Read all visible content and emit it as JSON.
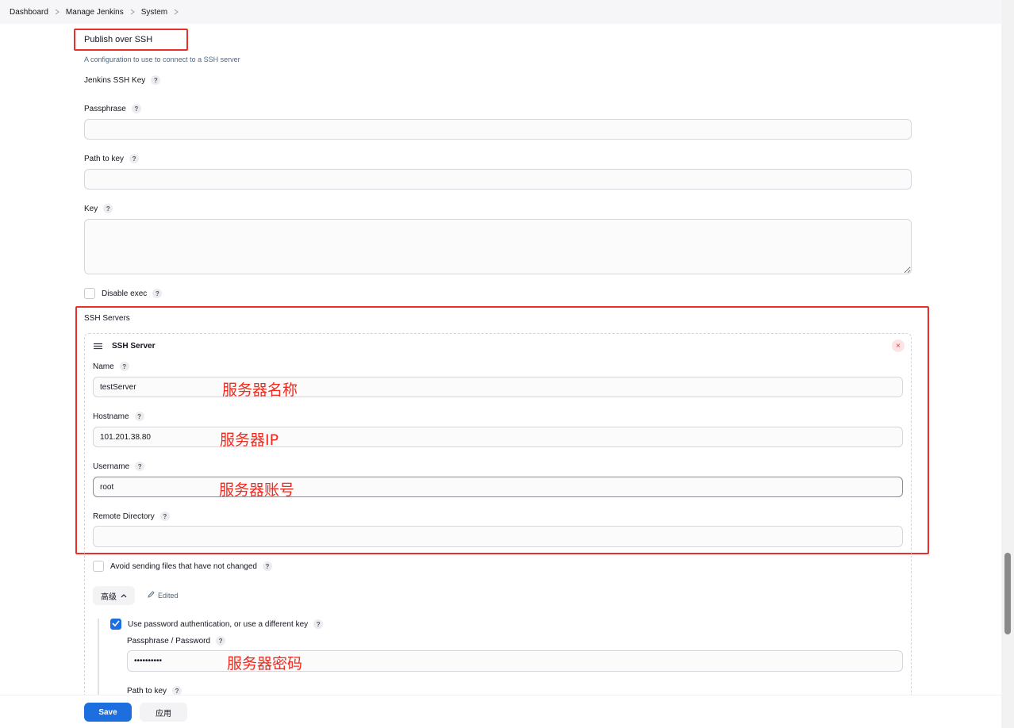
{
  "breadcrumb": [
    "Dashboard",
    "Manage Jenkins",
    "System"
  ],
  "section": {
    "title": "Publish over SSH",
    "description": "A configuration to use to connect to a SSH server"
  },
  "global": {
    "jenkins_ssh_key_label": "Jenkins SSH Key",
    "passphrase_label": "Passphrase",
    "passphrase_value": "",
    "path_to_key_label": "Path to key",
    "path_to_key_value": "",
    "key_label": "Key",
    "key_value": "",
    "disable_exec_label": "Disable exec",
    "disable_exec_checked": false
  },
  "ssh_servers": {
    "label": "SSH Servers",
    "server": {
      "header": "SSH Server",
      "remove_glyph": "×",
      "name_label": "Name",
      "name_value": "testServer",
      "hostname_label": "Hostname",
      "hostname_value": "101.201.38.80",
      "username_label": "Username",
      "username_value": "root",
      "remote_dir_label": "Remote Directory",
      "remote_dir_value": "",
      "avoid_label": "Avoid sending files that have not changed",
      "avoid_checked": false,
      "advanced_label": "高级",
      "edited_label": "Edited",
      "use_password_label": "Use password authentication, or use a different key",
      "use_password_checked": true,
      "password_label": "Passphrase / Password",
      "password_value": "••••••••••",
      "path_to_key_label": "Path to key"
    }
  },
  "annotations": {
    "name": "服务器名称",
    "hostname": "服务器IP",
    "username": "服务器账号",
    "password": "服务器密码"
  },
  "actions": {
    "save": "Save",
    "apply": "应用"
  },
  "help_glyph": "?",
  "colors": {
    "accent": "#1d6fe0",
    "annotation": "#f02a1c",
    "highlight_border": "#e8302b"
  },
  "icons": {
    "separator": "chevron-right-icon",
    "drag": "drag-handle-icon",
    "advanced_toggle": "chevron-up-icon",
    "edited": "pencil-icon",
    "check": "check-icon"
  }
}
